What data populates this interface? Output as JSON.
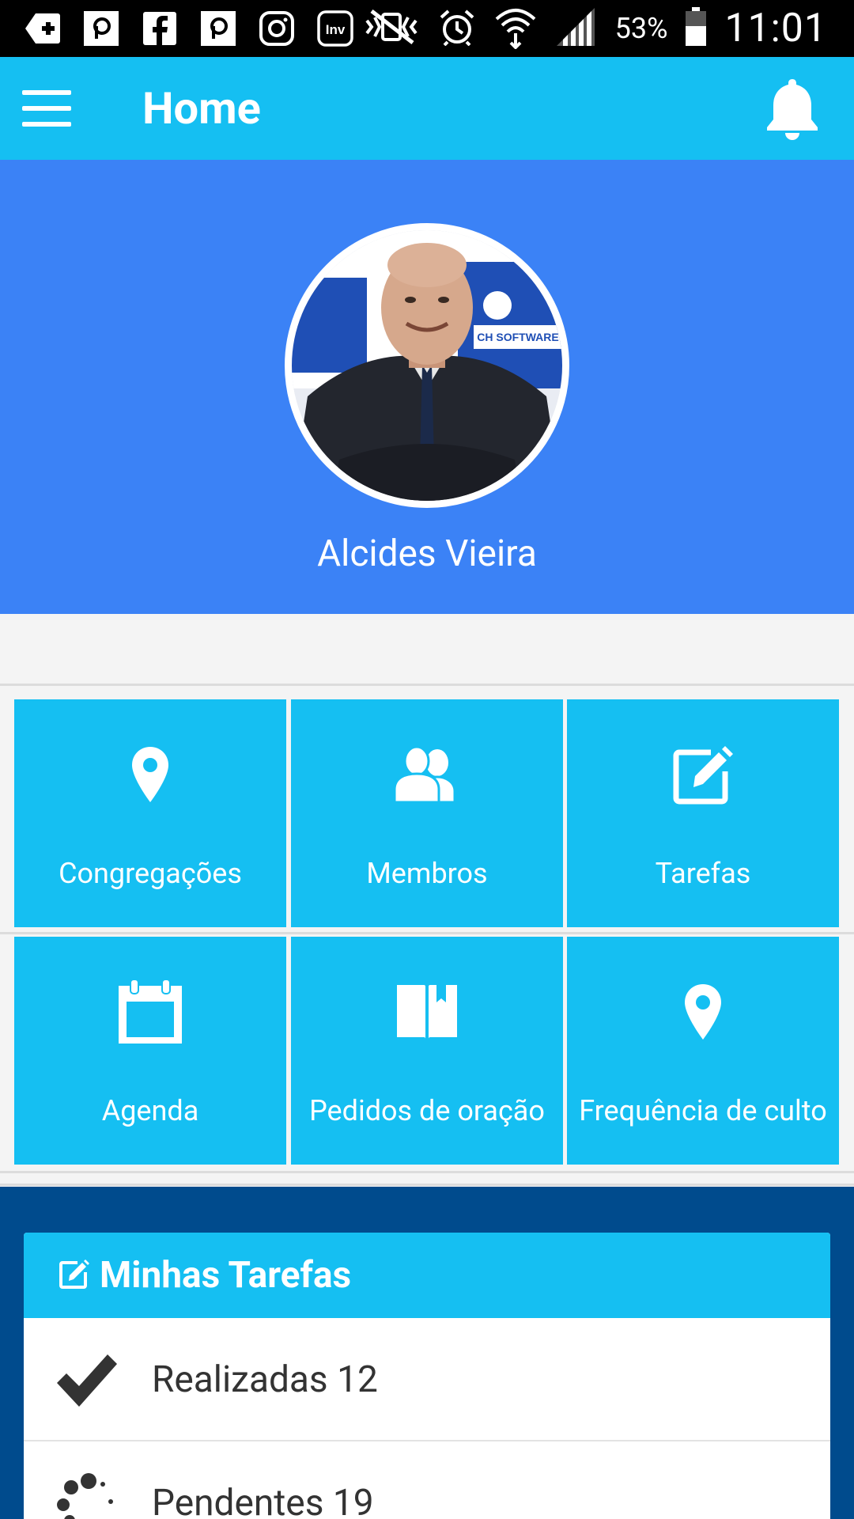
{
  "status_bar": {
    "left_icons": [
      "add-box-icon",
      "app-p-icon",
      "facebook-icon",
      "app-p-icon",
      "instagram-icon",
      "inv-icon"
    ],
    "inv_text": "Inv",
    "battery_percent": "53%",
    "time": "11:01"
  },
  "toolbar": {
    "title": "Home"
  },
  "profile": {
    "name": "Alcides Vieira",
    "photo_banner_text": "CH SOFTWARE"
  },
  "menu_tiles": [
    {
      "label": "Congregações",
      "icon": "map-marker-icon"
    },
    {
      "label": "Membros",
      "icon": "users-icon"
    },
    {
      "label": "Tarefas",
      "icon": "edit-icon"
    },
    {
      "label": "Agenda",
      "icon": "calendar-icon"
    },
    {
      "label": "Pedidos de oração",
      "icon": "book-icon"
    },
    {
      "label": "Frequência de culto",
      "icon": "map-marker-icon"
    }
  ],
  "tasks": {
    "title": "Minhas Tarefas",
    "rows": [
      {
        "label": "Realizadas 12",
        "icon": "check-icon"
      },
      {
        "label": "Pendentes 19",
        "icon": "spinner-icon"
      }
    ]
  },
  "colors": {
    "toolbar": "#15bff2",
    "profile_bg": "#3b82f6",
    "tiles": "#15bff2",
    "tasks_bg": "#004b8d"
  }
}
